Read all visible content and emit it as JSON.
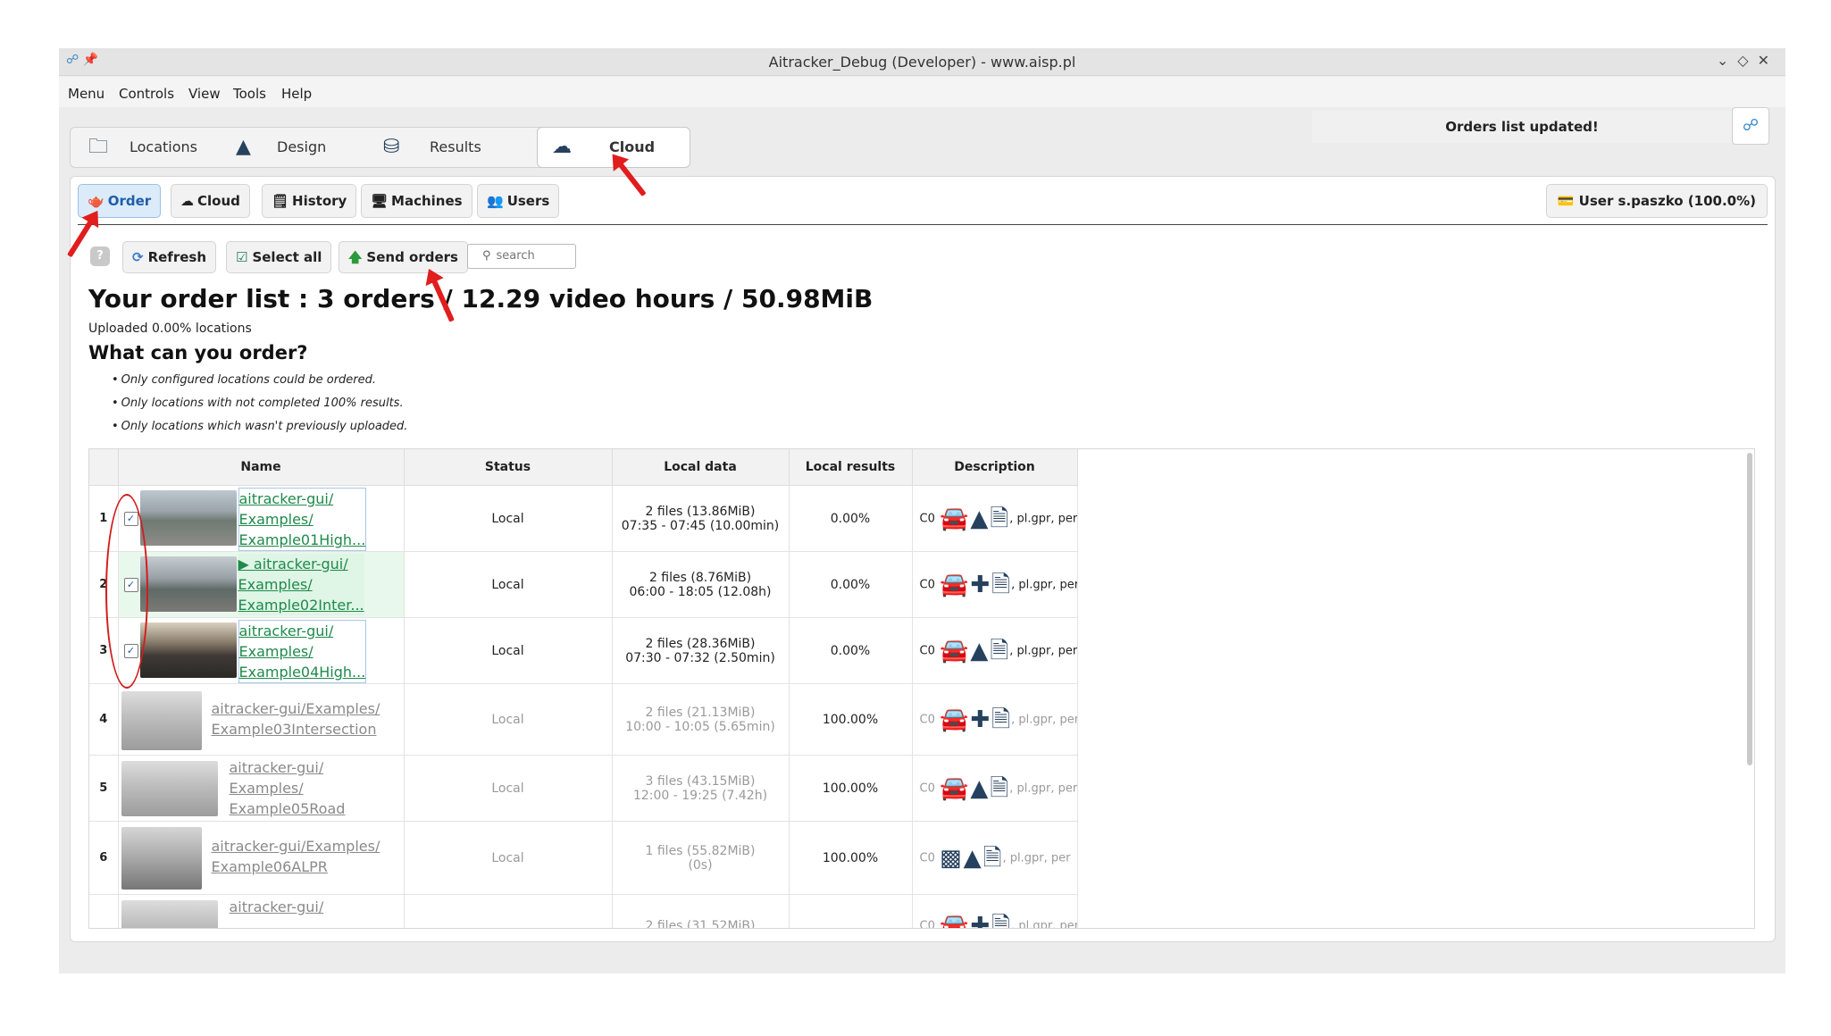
{
  "window": {
    "title": "Aitracker_Debug (Developer) - www.aisp.pl"
  },
  "menubar": {
    "items": [
      "Menu",
      "Controls",
      "View",
      "Tools",
      "Help"
    ]
  },
  "notification": "Orders list updated!",
  "main_tabs": [
    {
      "label": "Locations",
      "icon": "folder-icon"
    },
    {
      "label": "Design",
      "icon": "road-icon"
    },
    {
      "label": "Results",
      "icon": "chart-icon"
    },
    {
      "label": "Cloud",
      "icon": "cloud-icon",
      "active": true
    }
  ],
  "sub_tabs": [
    {
      "label": "Order",
      "active": true
    },
    {
      "label": "Cloud"
    },
    {
      "label": "History"
    },
    {
      "label": "Machines"
    },
    {
      "label": "Users"
    }
  ],
  "user_button": "User s.paszko (100.0%)",
  "toolbar": {
    "help": "?",
    "refresh": "Refresh",
    "select_all": "Select all",
    "send_orders": "Send orders",
    "search_placeholder": "search"
  },
  "heading": "Your order list : 3 orders / 12.29 video hours / 50.98MiB",
  "uploaded": "Uploaded 0.00% locations",
  "subheading": "What can you order?",
  "bullets": [
    "Only configured locations could be ordered.",
    "Only locations with not completed 100% results.",
    "Only locations which wasn't previously uploaded."
  ],
  "table": {
    "columns": [
      "",
      "Name",
      "Status",
      "Local data",
      "Local results",
      "Description"
    ],
    "rows": [
      {
        "num": "1",
        "checked": true,
        "name": [
          "aitracker-gui/",
          "Examples/",
          "Example01High..."
        ],
        "status": "Local",
        "files": "2  files (13.86MiB)",
        "time": "07:35 - 07:45 (10.00min)",
        "results": "0.00%",
        "desc": "C0",
        "desc_tail": ", pl.gpr, per fi"
      },
      {
        "num": "2",
        "checked": true,
        "name": [
          "▶ aitracker-gui/",
          "Examples/",
          "Example02Inter..."
        ],
        "status": "Local",
        "files": "2  files (8.76MiB)",
        "time": "06:00 - 18:05 (12.08h)",
        "results": "0.00%",
        "desc": "C0",
        "desc_tail": ", pl.gpr, per file"
      },
      {
        "num": "3",
        "checked": true,
        "name": [
          "aitracker-gui/",
          "Examples/",
          "Example04High..."
        ],
        "status": "Local",
        "files": "2  files (28.36MiB)",
        "time": "07:30 - 07:32 (2.50min)",
        "results": "0.00%",
        "desc": "C0",
        "desc_tail": ", pl.gpr, per fi"
      },
      {
        "num": "4",
        "checked": false,
        "name": [
          "aitracker-gui/Examples/",
          "Example03Intersection"
        ],
        "status": "Local",
        "files": "2  files (21.13MiB)",
        "time": "10:00 - 10:05 (5.65min)",
        "results": "100.00%",
        "desc": "C0",
        "desc_tail": ", pl.gpr, per file"
      },
      {
        "num": "5",
        "checked": false,
        "name": [
          "aitracker-gui/",
          "Examples/",
          "Example05Road"
        ],
        "status": "Local",
        "files": "3  files (43.15MiB)",
        "time": "12:00 - 19:25 (7.42h)",
        "results": "100.00%",
        "desc": "C0",
        "desc_tail": ", pl.gpr, per fi"
      },
      {
        "num": "6",
        "checked": false,
        "name": [
          "aitracker-gui/Examples/",
          "Example06ALPR"
        ],
        "status": "Local",
        "files": "1  files (55.82MiB)",
        "time": "(0s)",
        "results": "100.00%",
        "desc": "C0",
        "desc_tail": ", pl.gpr, per"
      },
      {
        "num": "",
        "checked": false,
        "name": [
          "aitracker-gui/",
          ""
        ],
        "status": "",
        "files": "2  files (31.52MiB)",
        "time": "",
        "results": "",
        "desc": "C0",
        "desc_tail": ", pl.gpr, per file"
      }
    ]
  }
}
